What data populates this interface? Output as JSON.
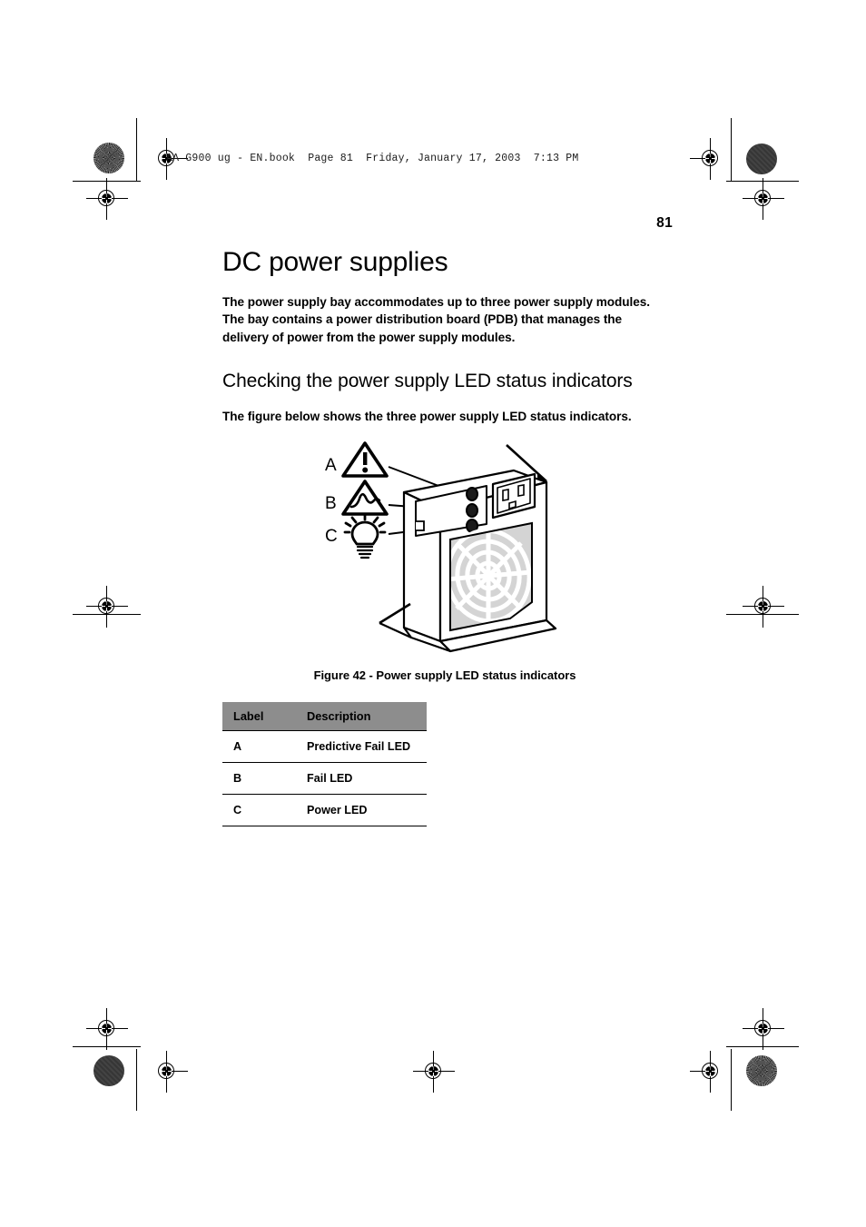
{
  "print_marks": {
    "header_line": "AA G900 ug - EN.book  Page 81  Friday, January 17, 2003  7:13 PM"
  },
  "page": {
    "folio": "81"
  },
  "content": {
    "chapter_title": "DC power supplies",
    "intro_paragraph": "The power supply bay accommodates up to three power supply modules.  The bay contains a power distribution board (PDB) that manages the delivery of power from the power supply modules.",
    "section_title": "Checking the power supply LED status indicators",
    "section_paragraph": "The figure below shows the three power supply LED status indicators."
  },
  "figure": {
    "caption": "Figure 42 - Power supply LED status indicators",
    "callouts": [
      {
        "label": "A",
        "icon": "warning-triangle-icon"
      },
      {
        "label": "B",
        "icon": "fail-triangle-icon"
      },
      {
        "label": "C",
        "icon": "lightbulb-icon"
      }
    ]
  },
  "table": {
    "headers": [
      "Label",
      "Description"
    ],
    "rows": [
      {
        "label": "A",
        "description": "Predictive Fail LED"
      },
      {
        "label": "B",
        "description": "Fail LED"
      },
      {
        "label": "C",
        "description": "Power LED"
      }
    ]
  },
  "colors": {
    "table_header_bg": "#8d8d8d",
    "fan_grille_fill": "#d4d4d4",
    "ink": "#000000",
    "paper": "#ffffff"
  }
}
